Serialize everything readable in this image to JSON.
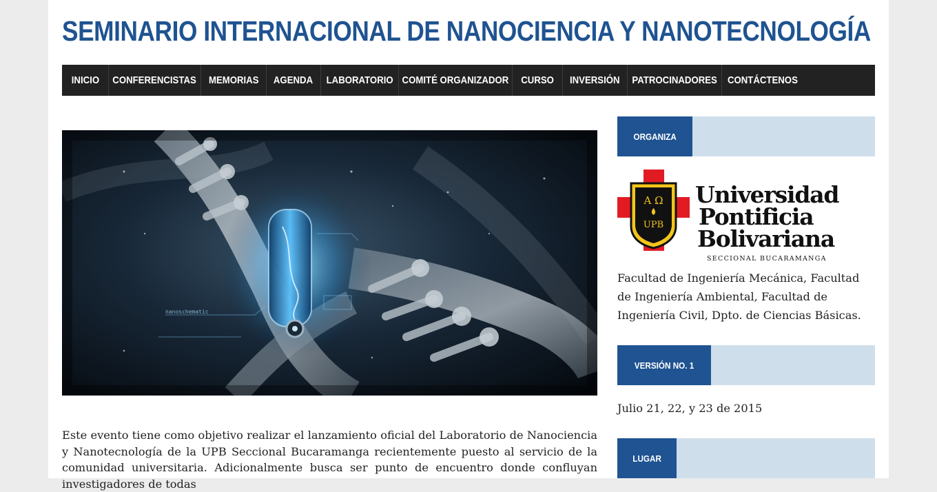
{
  "site": {
    "title": "SEMINARIO INTERNACIONAL DE NANOCIENCIA Y NANOTECNOLOGÍA"
  },
  "nav": {
    "items": [
      {
        "label": "INICIO"
      },
      {
        "label": "CONFERENCISTAS"
      },
      {
        "label": "MEMORIAS"
      },
      {
        "label": "AGENDA"
      },
      {
        "label": "LABORATORIO"
      },
      {
        "label": "COMITÉ ORGANIZADOR"
      },
      {
        "label": "CURSO"
      },
      {
        "label": "INVERSIÓN"
      },
      {
        "label": "PATROCINADORES"
      },
      {
        "label": "CONTÁCTENOS"
      }
    ]
  },
  "hero": {
    "overlay_text": "nanoschematic"
  },
  "main": {
    "intro": "Este evento tiene como objetivo realizar el lanzamiento oficial del Laboratorio de Nanociencia y Nanotecnología de la UPB Seccional Bucaramanga recientemente puesto al servicio de la comunidad universitaria. Adicionalmente busca ser punto de encuentro donde confluyan investigadores de todas"
  },
  "sidebar": {
    "organiza": {
      "heading": "ORGANIZA",
      "logo": {
        "crest_top": "Α Ω",
        "crest_bottom": "UPB",
        "name_line1": "Universidad",
        "name_line2": "Pontificia",
        "name_line3": "Bolivariana",
        "subtitle": "SECCIONAL BUCARAMANGA"
      },
      "text": "Facultad de Ingeniería Mecánica, Facultad de Ingeniería Ambiental, Facultad de Ingeniería Civil, Dpto. de Ciencias Básicas."
    },
    "version": {
      "heading": "VERSIÓN NO. 1",
      "text": "Julio 21, 22, y 23 de 2015"
    },
    "lugar": {
      "heading": "LUGAR"
    }
  },
  "colors": {
    "brand_blue": "#1f5391",
    "widget_bg": "#cfdeeb",
    "nav_bg": "#222222",
    "crest_red": "#e21b23",
    "crest_gold": "#f3c51b"
  },
  "icons": {
    "crest": "upb-crest-icon"
  }
}
